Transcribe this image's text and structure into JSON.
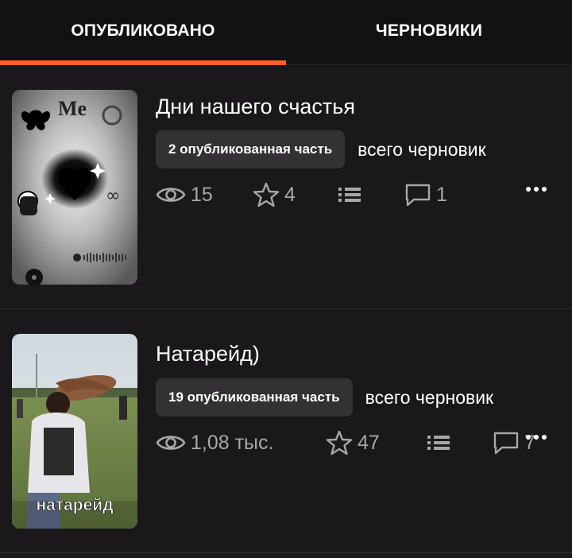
{
  "tabs": [
    {
      "label": "ОПУБЛИКОВАНО",
      "active": true
    },
    {
      "label": "ЧЕРНОВИКИ",
      "active": false
    }
  ],
  "colors": {
    "accent": "#ff6122",
    "background": "#1a181a",
    "pill": "#333133",
    "stat_text": "#a8a6a8"
  },
  "stories": [
    {
      "title": "Дни нашего счастья",
      "published_parts": "2 опубликованная часть",
      "drafts_text": "всего черновик",
      "views": "15",
      "votes": "4",
      "comments": "1",
      "cover_text": "Me",
      "icons": [
        "eye-icon",
        "star-icon",
        "list-icon",
        "comment-icon",
        "more-dots-icon"
      ]
    },
    {
      "title": "Натарейд)",
      "published_parts": "19 опубликованная часть",
      "drafts_text": "всего черновик",
      "views": "1,08 тыс.",
      "votes": "47",
      "comments": "7",
      "cover_text": "натарейд",
      "icons": [
        "eye-icon",
        "star-icon",
        "list-icon",
        "comment-icon",
        "more-dots-icon"
      ]
    }
  ]
}
